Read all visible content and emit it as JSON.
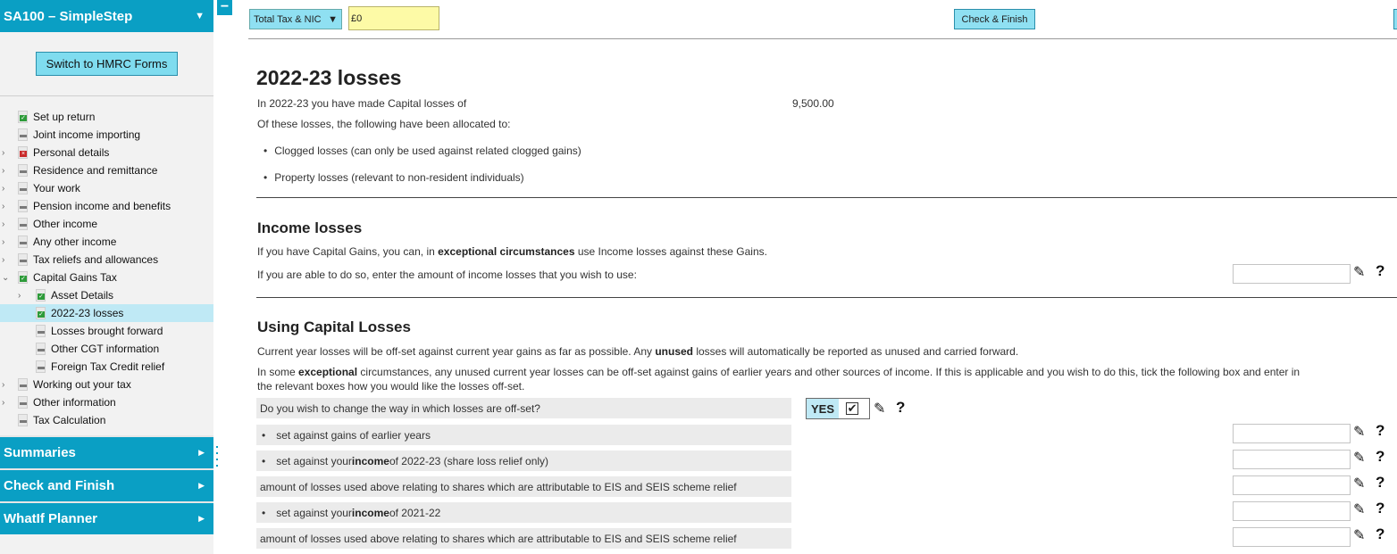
{
  "sidebar": {
    "title": "SA100 – SimpleStep",
    "switch_label": "Switch to HMRC Forms",
    "items": [
      {
        "label": "Set up return",
        "level": 1,
        "status": "ok",
        "expander": ""
      },
      {
        "label": "Joint income importing",
        "level": 1,
        "status": "none",
        "expander": ""
      },
      {
        "label": "Personal details",
        "level": 1,
        "status": "err",
        "expander": ">"
      },
      {
        "label": "Residence and remittance",
        "level": 1,
        "status": "none",
        "expander": ">"
      },
      {
        "label": "Your work",
        "level": 1,
        "status": "none",
        "expander": ">"
      },
      {
        "label": "Pension income and benefits",
        "level": 1,
        "status": "none",
        "expander": ">"
      },
      {
        "label": "Other income",
        "level": 1,
        "status": "none",
        "expander": ">"
      },
      {
        "label": "Any other income",
        "level": 1,
        "status": "none",
        "expander": ">"
      },
      {
        "label": "Tax reliefs and allowances",
        "level": 1,
        "status": "none",
        "expander": ">"
      },
      {
        "label": "Capital Gains Tax",
        "level": 1,
        "status": "ok",
        "expander": "v"
      },
      {
        "label": "Asset Details",
        "level": 2,
        "status": "ok",
        "expander": ">"
      },
      {
        "label": "2022-23 losses",
        "level": 2,
        "status": "ok",
        "expander": "",
        "selected": true
      },
      {
        "label": "Losses brought forward",
        "level": 2,
        "status": "none",
        "expander": ""
      },
      {
        "label": "Other CGT information",
        "level": 2,
        "status": "none",
        "expander": ""
      },
      {
        "label": "Foreign Tax Credit relief",
        "level": 2,
        "status": "none",
        "expander": ""
      },
      {
        "label": "Working out your tax",
        "level": 1,
        "status": "none",
        "expander": ">"
      },
      {
        "label": "Other information",
        "level": 1,
        "status": "none",
        "expander": ">"
      },
      {
        "label": "Tax Calculation",
        "level": 1,
        "status": "none",
        "expander": ""
      }
    ],
    "sections": [
      "Summaries",
      "Check and Finish",
      "WhatIf Planner"
    ]
  },
  "topbar": {
    "select_label": "Total Tax & NIC",
    "value": "£0",
    "check_finish": "Check & Finish"
  },
  "main": {
    "title": "2022-23 losses",
    "capital_losses_text": "In 2022-23 you have made Capital losses of",
    "capital_losses_value": "9,500.00",
    "allocated_text": "Of these losses, the following have been allocated to:",
    "bullet_clogged": "Clogged losses (can only be used against related clogged gains)",
    "bullet_property": "Property losses (relevant to non-resident individuals)",
    "income_losses": {
      "heading": "Income losses",
      "p1_a": "If you have Capital Gains, you can, in ",
      "p1_b": "exceptional circumstances",
      "p1_c": " use Income losses against these Gains.",
      "p2": "If you are able to do so, enter the amount of income losses that you wish to use:"
    },
    "using_capital": {
      "heading": "Using Capital Losses",
      "p1_a": "Current year losses will be off-set against current year gains as far as possible. Any ",
      "p1_b": "unused",
      "p1_c": " losses will automatically be reported as unused and carried forward.",
      "p2_a": "In some ",
      "p2_b": "exceptional",
      "p2_c": " circumstances, any unused current year losses can be off-set against gains of earlier years and other sources of income. If this is applicable and you wish to do this, tick the following box and enter in",
      "p2_d": "the relevant boxes how you would like the losses off-set.",
      "question": "Do you wish to change the way in which losses are off-set?",
      "yes_label": "YES",
      "check_mark": "☑",
      "row1": "set against gains of earlier years",
      "row2_a": "set against your ",
      "row2_b": "income",
      "row2_c": " of 2022-23 (share loss relief only)",
      "row3": "amount of losses used above relating to shares which are attributable to EIS and SEIS scheme relief",
      "row4_a": "set against your ",
      "row4_b": "income",
      "row4_c": " of 2021-22",
      "row5": "amount of losses used above relating to shares which are attributable to EIS and SEIS scheme relief"
    }
  },
  "icons": {
    "pencil": "✎",
    "help": "?",
    "dot": "•",
    "collapse": "−",
    "down": "▼",
    "right": "▶"
  },
  "colors": {
    "accent": "#0a9fc4",
    "button": "#8fe0f2",
    "value_bg": "#fdfaa6",
    "selected": "#bfe9f5"
  }
}
